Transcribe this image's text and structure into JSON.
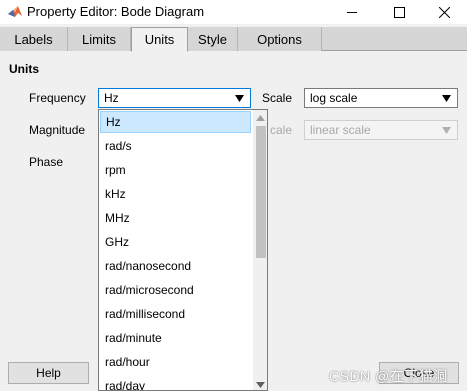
{
  "window": {
    "title": "Property Editor: Bode Diagram"
  },
  "tabs": [
    {
      "label": "Labels"
    },
    {
      "label": "Limits"
    },
    {
      "label": "Units",
      "active": true
    },
    {
      "label": "Style"
    },
    {
      "label": "Options"
    }
  ],
  "units": {
    "section_title": "Units",
    "frequency": {
      "label": "Frequency",
      "value": "Hz",
      "scale_label": "Scale",
      "scale_value": "log scale"
    },
    "magnitude": {
      "label": "Magnitude",
      "scale_label_partial": "cale",
      "scale_value": "linear scale"
    },
    "phase": {
      "label": "Phase"
    }
  },
  "dropdown": {
    "selected": "Hz",
    "options": [
      "Hz",
      "rad/s",
      "rpm",
      "kHz",
      "MHz",
      "GHz",
      "rad/nanosecond",
      "rad/microsecond",
      "rad/millisecond",
      "rad/minute",
      "rad/hour",
      "rad/day"
    ]
  },
  "buttons": {
    "help": "Help",
    "close": "Close"
  },
  "watermark": "CSDN @在下猫洞",
  "icons": {
    "app": "matlab-icon",
    "minimize": "minimize-icon",
    "maximize": "maximize-icon",
    "close": "close-icon",
    "dropdown_arrow": "chevron-down-icon"
  }
}
